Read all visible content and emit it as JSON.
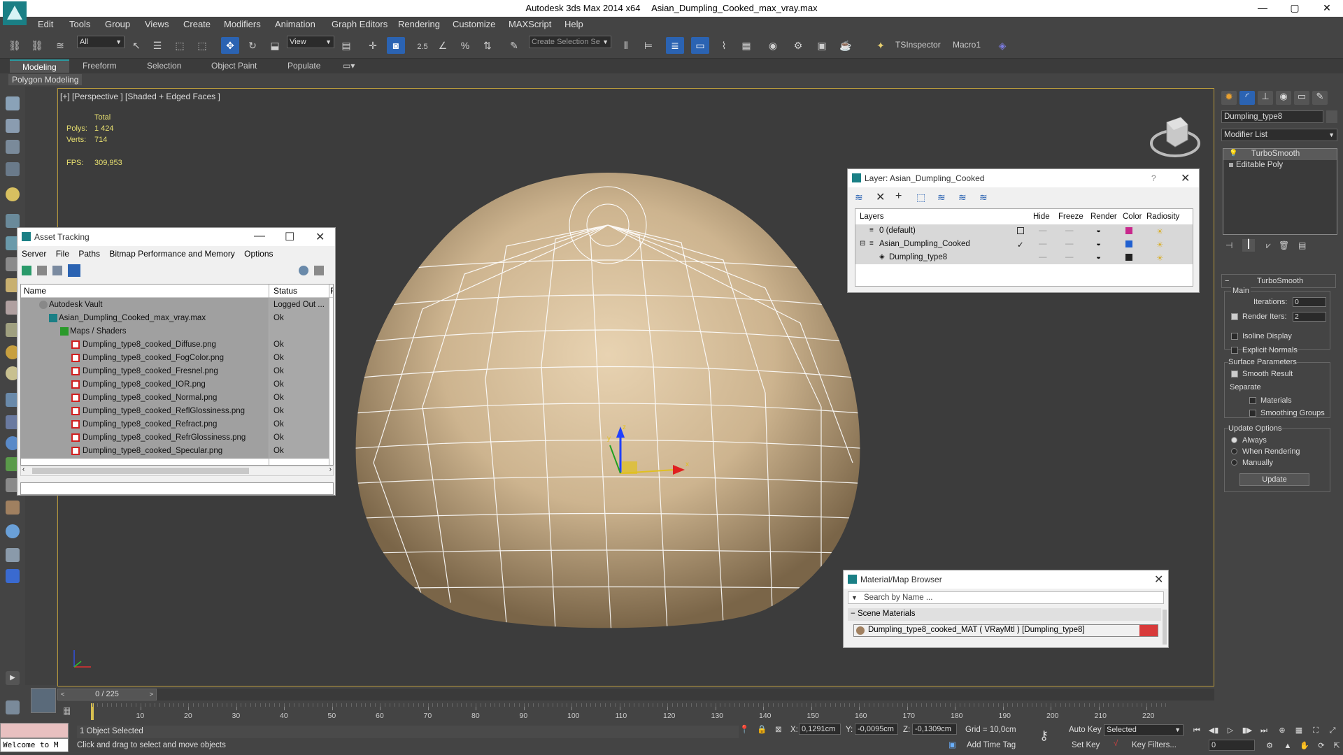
{
  "window": {
    "app_title": "Autodesk 3ds Max  2014 x64",
    "file_name": "Asian_Dumpling_Cooked_max_vray.max",
    "minimize": "—",
    "maximize": "▢",
    "close": "✕"
  },
  "menu": [
    "Edit",
    "Tools",
    "Group",
    "Views",
    "Create",
    "Modifiers",
    "Animation",
    "Graph Editors",
    "Rendering",
    "Customize",
    "MAXScript",
    "Help"
  ],
  "main_toolbar": {
    "filter_value": "All",
    "refcoord_value": "View",
    "snap_value": "2.5",
    "selection_set_placeholder": "Create Selection Se",
    "tsinspector": "TSInspector",
    "macro1": "Macro1"
  },
  "ribbon": {
    "tabs": [
      "Modeling",
      "Freeform",
      "Selection",
      "Object Paint",
      "Populate"
    ],
    "active_tab": "Modeling",
    "sub_label": "Polygon Modeling"
  },
  "viewport": {
    "label": "[+] [Perspective ] [Shaded + Edged Faces ]",
    "stats": {
      "header": "Total",
      "polys_label": "Polys:",
      "polys_value": "1 424",
      "verts_label": "Verts:",
      "verts_value": "714",
      "fps_label": "FPS:",
      "fps_value": "309,953"
    },
    "axis_x": "x",
    "axis_y": "y",
    "axis_z": "z"
  },
  "asset_tracking": {
    "title": "Asset Tracking",
    "menu": [
      "Server",
      "File",
      "Paths",
      "Bitmap Performance and Memory",
      "Options"
    ],
    "col_name": "Name",
    "col_status": "Status",
    "col_extra": "F",
    "rows": [
      {
        "name": "Autodesk Vault",
        "status": "Logged Out ..."
      },
      {
        "name": "Asian_Dumpling_Cooked_max_vray.max",
        "status": "Ok"
      },
      {
        "name": "Maps / Shaders",
        "status": ""
      },
      {
        "name": "Dumpling_type8_cooked_Diffuse.png",
        "status": "Ok"
      },
      {
        "name": "Dumpling_type8_cooked_FogColor.png",
        "status": "Ok"
      },
      {
        "name": "Dumpling_type8_cooked_Fresnel.png",
        "status": "Ok"
      },
      {
        "name": "Dumpling_type8_cooked_IOR.png",
        "status": "Ok"
      },
      {
        "name": "Dumpling_type8_cooked_Normal.png",
        "status": "Ok"
      },
      {
        "name": "Dumpling_type8_cooked_ReflGlossiness.png",
        "status": "Ok"
      },
      {
        "name": "Dumpling_type8_cooked_Refract.png",
        "status": "Ok"
      },
      {
        "name": "Dumpling_type8_cooked_RefrGlossiness.png",
        "status": "Ok"
      },
      {
        "name": "Dumpling_type8_cooked_Specular.png",
        "status": "Ok"
      }
    ]
  },
  "layer_panel": {
    "title": "Layer: Asian_Dumpling_Cooked",
    "help": "?",
    "columns": [
      "Layers",
      "Hide",
      "Freeze",
      "Render",
      "Color",
      "Radiosity"
    ],
    "rows": [
      {
        "name": "0 (default)",
        "color": "#c8288c"
      },
      {
        "name": "Asian_Dumpling_Cooked",
        "color": "#2060d0"
      },
      {
        "name": "Dumpling_type8",
        "color": "#222222"
      }
    ]
  },
  "material_browser": {
    "title": "Material/Map Browser",
    "search_placeholder": "Search by Name ...",
    "section": "Scene Materials",
    "material": "Dumpling_type8_cooked_MAT ( VRayMtl ) [Dumpling_type8]"
  },
  "command_panel": {
    "object_name": "Dumpling_type8",
    "modifier_list": "Modifier List",
    "stack": [
      "TurboSmooth",
      "Editable Poly"
    ],
    "turbosmooth": {
      "title": "TurboSmooth",
      "main": "Main",
      "iterations_label": "Iterations:",
      "iterations_value": "0",
      "render_iters_label": "Render Iters:",
      "render_iters_value": "2",
      "isoline": "Isoline Display",
      "explicit_normals": "Explicit Normals",
      "surface_params": "Surface Parameters",
      "smooth_result": "Smooth Result",
      "separate": "Separate",
      "materials": "Materials",
      "smoothing_groups": "Smoothing Groups",
      "update_options": "Update Options",
      "always": "Always",
      "when_rendering": "When Rendering",
      "manually": "Manually",
      "update_button": "Update"
    }
  },
  "timeline": {
    "frame_display": "0 / 225",
    "ticks": [
      "10",
      "20",
      "30",
      "40",
      "50",
      "60",
      "70",
      "80",
      "90",
      "100",
      "110",
      "120",
      "130",
      "140",
      "150",
      "160",
      "170",
      "180",
      "190",
      "200",
      "210",
      "220"
    ]
  },
  "status": {
    "welcome": "Welcome to M",
    "selected": "1 Object Selected",
    "prompt": "Click and drag to select and move objects",
    "x_label": "X:",
    "x_value": "0,1291cm",
    "y_label": "Y:",
    "y_value": "-0,0095cm",
    "z_label": "Z:",
    "z_value": "-0,1309cm",
    "grid": "Grid = 10,0cm",
    "add_time_tag": "Add Time Tag",
    "auto_key": "Auto Key",
    "set_key": "Set Key",
    "selected_dropdown": "Selected",
    "key_filters": "Key Filters...",
    "frame_value": "0"
  }
}
